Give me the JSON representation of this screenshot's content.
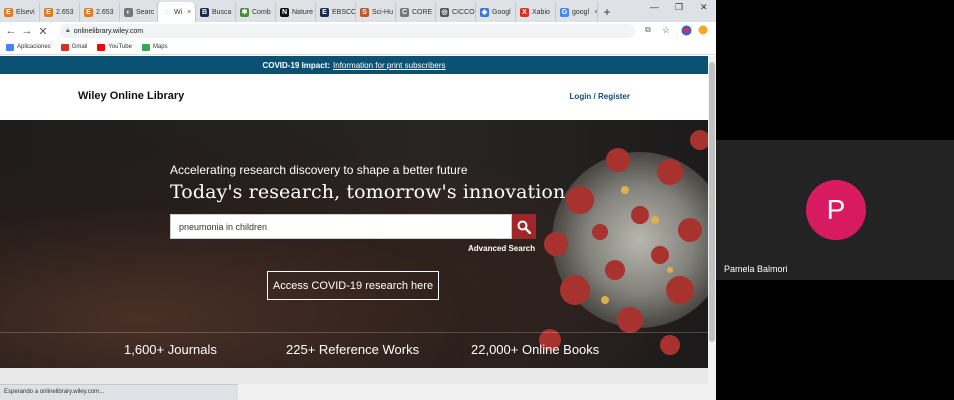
{
  "browser": {
    "tabs": [
      {
        "label": "Elsevi",
        "icon": "elsevier-icon",
        "color": "#e07b1f",
        "glyph": "E"
      },
      {
        "label": "2.653",
        "icon": "elsevier-icon",
        "color": "#e07b1f",
        "glyph": "E"
      },
      {
        "label": "2.653",
        "icon": "elsevier-icon",
        "color": "#e07b1f",
        "glyph": "E"
      },
      {
        "label": "Searc",
        "icon": "search-tab-icon",
        "color": "#777777",
        "glyph": "◐"
      },
      {
        "label": "Wi",
        "icon": "loading-icon",
        "color": "#ffffff",
        "glyph": "◌"
      },
      {
        "label": "Busca",
        "icon": "library-icon",
        "color": "#1b2a4a",
        "glyph": "B"
      },
      {
        "label": "Comb",
        "icon": "puzzle-icon",
        "color": "#4a8c3f",
        "glyph": "✱"
      },
      {
        "label": "Nature",
        "icon": "nature-icon",
        "color": "#111111",
        "glyph": "N"
      },
      {
        "label": "EBSCO",
        "icon": "ebsco-icon",
        "color": "#1b2a4a",
        "glyph": "E"
      },
      {
        "label": "Sci-Hu",
        "icon": "scihub-icon",
        "color": "#c1562a",
        "glyph": "S"
      },
      {
        "label": "CORE",
        "icon": "core-icon",
        "color": "#777777",
        "glyph": "C"
      },
      {
        "label": "CICCO",
        "icon": "globe-icon",
        "color": "#555555",
        "glyph": "◎"
      },
      {
        "label": "Googl",
        "icon": "google-drive-icon",
        "color": "#3b78e7",
        "glyph": "◆"
      },
      {
        "label": "Xabio",
        "icon": "xabio-icon",
        "color": "#d93025",
        "glyph": "X"
      },
      {
        "label": "googl",
        "icon": "google-icon",
        "color": "#4285f4",
        "glyph": "G"
      }
    ],
    "url": "onlinelibrary.wiley.com",
    "bookmarks": [
      {
        "label": "Aplicaciones",
        "icon": "apps-icon",
        "color": "#4285f4"
      },
      {
        "label": "Gmail",
        "icon": "gmail-icon",
        "color": "#d93025"
      },
      {
        "label": "YouTube",
        "icon": "youtube-icon",
        "color": "#ff0000"
      },
      {
        "label": "Maps",
        "icon": "maps-icon",
        "color": "#34a853"
      }
    ],
    "status_text": "Esperando a onlinelibrary.wiley.com..."
  },
  "page": {
    "covid_label": "COVID-19 Impact:",
    "covid_link": "Information for print subscribers",
    "logo": "Wiley Online Library",
    "login": "Login / Register",
    "tagline": "Accelerating research discovery to shape a better future",
    "title": "Today's research, tomorrow's innovation",
    "search_value": "pneumonia in children",
    "advanced_search": "Advanced Search",
    "covid_button": "Access COVID-19 research here",
    "stats": [
      "1,600+ Journals",
      "225+ Reference Works",
      "22,000+ Online Books"
    ]
  },
  "call": {
    "avatar_initial": "P",
    "participant_name": "Pamela Balmori",
    "avatar_color": "#d81b60"
  }
}
